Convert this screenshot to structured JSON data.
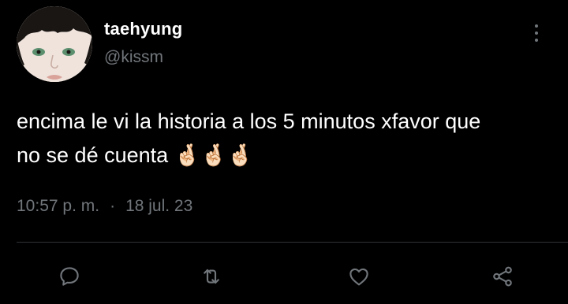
{
  "user": {
    "display_name": "taehyung",
    "handle": "@kissm"
  },
  "tweet": {
    "text": "encima le vi la historia a los 5 minutos xfavor que\nno se dé cuenta 🤞🏻🤞🏻🤞🏻",
    "time": "10:57 p. m.",
    "separator": "·",
    "date": "18 jul. 23"
  },
  "actions": {
    "reply_icon": "speech-bubble",
    "retweet_icon": "retweet-arrows",
    "like_icon": "heart",
    "share_icon": "share-nodes"
  },
  "colors": {
    "background": "#000000",
    "text": "#ffffff",
    "secondary": "#71767b",
    "divider": "#2f3336"
  }
}
